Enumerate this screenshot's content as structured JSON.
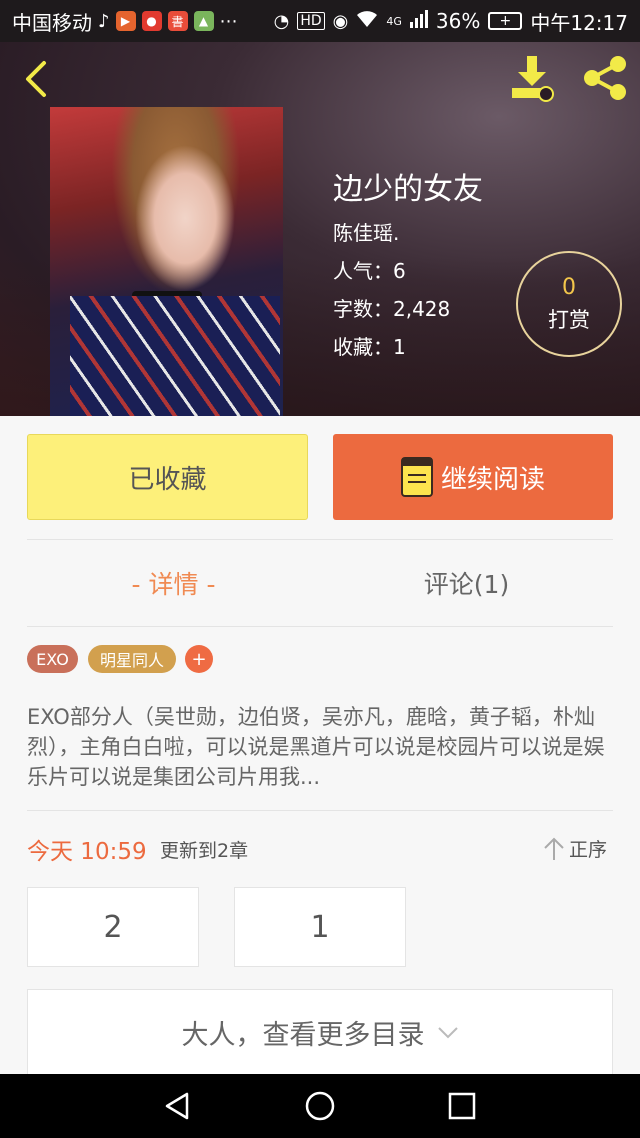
{
  "status_bar": {
    "carrier": "中国移动",
    "network": "4G",
    "battery": "36%",
    "time": "中午12:17"
  },
  "book": {
    "title": "边少的女友",
    "author": "陈佳瑶.",
    "popularity": "人气：6",
    "word_count": "字数：2,428",
    "favorites": "收藏：1"
  },
  "reward": {
    "count": "0",
    "label": "打赏"
  },
  "actions": {
    "collected_label": "已收藏",
    "continue_label": "继续阅读"
  },
  "tabs": {
    "detail": "- 详情 -",
    "comments": "评论(1)"
  },
  "tags": [
    {
      "label": "EXO",
      "color": "#c9705a"
    },
    {
      "label": "明星同人",
      "color": "#d2a04e"
    },
    {
      "label": "+",
      "color": "#ef6b43"
    }
  ],
  "description": "EXO部分人（吴世勋，边伯贤，吴亦凡，鹿晗，黄子韬，朴灿烈），主角白白啦，可以说是黑道片可以说是校园片可以说是娱乐片可以说是集团公司片用我...",
  "update": {
    "when": "今天 10:59",
    "text": "更新到2章",
    "sort_label": "正序"
  },
  "chapters": [
    "2",
    "1"
  ],
  "more_toc": "大人，查看更多目录",
  "colors": {
    "accent": "#ec6a3f",
    "collected": "#fdf07a"
  }
}
